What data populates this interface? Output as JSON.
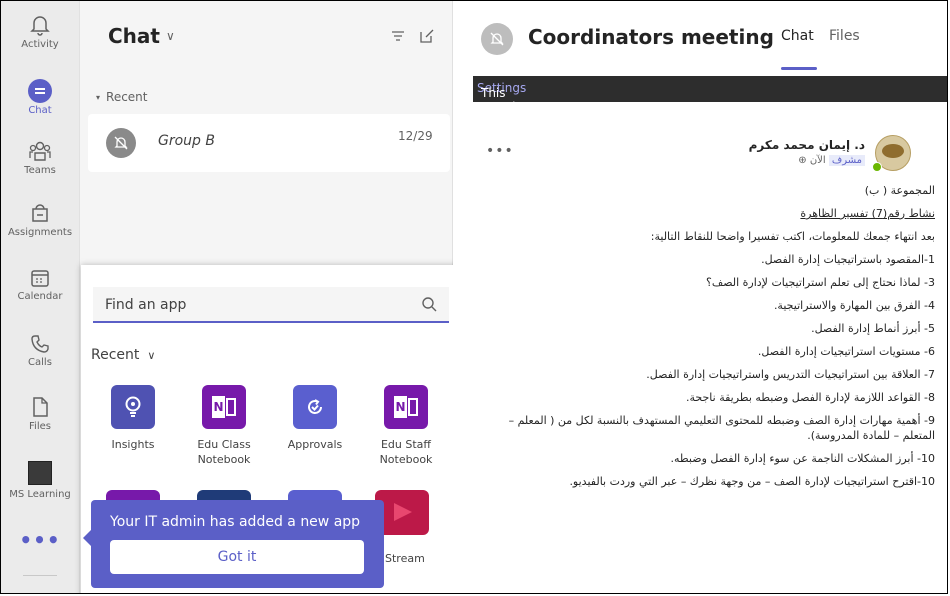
{
  "rail": {
    "items": [
      {
        "label": "Activity"
      },
      {
        "label": "Chat"
      },
      {
        "label": "Teams"
      },
      {
        "label": "Assignments"
      },
      {
        "label": "Calendar"
      },
      {
        "label": "Calls"
      },
      {
        "label": "Files"
      },
      {
        "label": "MS Learning"
      }
    ],
    "more": "•••"
  },
  "chat_list": {
    "title": "Chat",
    "title_chevron": "∨",
    "section": "Recent",
    "chats": [
      {
        "name": "Group B",
        "date": "12/29"
      }
    ]
  },
  "app_flyout": {
    "search_placeholder": "Find an app",
    "section": "Recent",
    "section_chevron": "∨",
    "apps": [
      {
        "name": "Insights"
      },
      {
        "name": "Edu Class Notebook"
      },
      {
        "name": "Approvals"
      },
      {
        "name": "Edu Staff Notebook"
      }
    ],
    "partial_app_label": "Stream"
  },
  "callout": {
    "message": "Your IT admin has added a new app",
    "button": "Got it"
  },
  "meeting": {
    "title": "Coordinators meeting",
    "tabs": [
      "Chat",
      "Files"
    ],
    "active_tab": "Chat",
    "muted_text": "This meeting chat is muted.",
    "muted_link": "Settings",
    "message": {
      "more": "•••",
      "sender": "د. إيمان محمد مكرم",
      "role": "مشرف",
      "time": "الآن",
      "lines": [
        "المجموعة ( ب)",
        "نشاط رقم(7) تفسير الظاهرة",
        "بعد انتهاء جمعك للمعلومات، اكتب تفسيرا واضحا للنقاط التالية:",
        "1-المقصود باستراتيجيات إدارة الفصل.",
        "3- لماذا نحتاج إلى تعلم استراتيجيات لإدارة الصف؟",
        "4- الفرق بين المهارة والاستراتيجية.",
        "5- أبرز أنماط إدارة الفصل.",
        "6- مستويات استراتيجيات إدارة الفصل.",
        "7- العلاقة بين استراتيجيات التدريس واستراتيجيات إدارة الفصل.",
        "8- القواعد اللازمة لإدارة الفصل وضبطه بطريقة ناجحة.",
        "9- أهمية مهارات إدارة الصف وضبطه للمحتوى التعليمي المستهدف بالنسبة لكل من ( المعلم – المتعلم – للمادة المدروسة).",
        "10- أبرز المشكلات الناجمة عن سوء إدارة الفصل وضبطه.",
        "10-اقترح استراتيجيات لإدارة الصف – من وجهة نظرك – عبر التي وردت بالفيديو."
      ]
    }
  },
  "colors": {
    "accent": "#5b5fc7",
    "rail_bg": "#ebebeb",
    "list_bg": "#f5f5f5",
    "muted_bar": "#2d2d2d",
    "onenote": "#7719aa",
    "stream": "#bc1948"
  }
}
